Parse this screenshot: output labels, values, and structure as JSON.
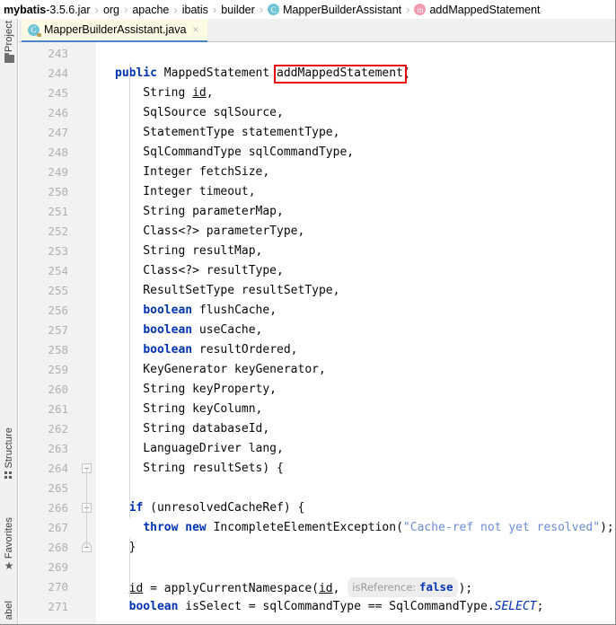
{
  "breadcrumb": {
    "jar_bold": "mybatis",
    "jar_rest": "-3.5.6.jar",
    "items": [
      {
        "label": "org",
        "icon": ""
      },
      {
        "label": "apache",
        "icon": ""
      },
      {
        "label": "ibatis",
        "icon": ""
      },
      {
        "label": "builder",
        "icon": ""
      },
      {
        "label": "MapperBuilderAssistant",
        "icon": "class-icon",
        "glyph": "C"
      },
      {
        "label": "addMappedStatement",
        "icon": "method-icon",
        "glyph": "m"
      }
    ],
    "separator": "›"
  },
  "toolwindows": [
    {
      "name": "project",
      "label": "Project",
      "icon": "folder-icon"
    },
    {
      "name": "structure",
      "label": "Structure",
      "icon": "structure-icon"
    },
    {
      "name": "favorites",
      "label": "Favorites",
      "icon": "star-icon"
    },
    {
      "name": "label",
      "label": "abel",
      "icon": ""
    }
  ],
  "tab": {
    "title": "MapperBuilderAssistant.java",
    "icon_glyph": "C",
    "close_glyph": "×"
  },
  "editor": {
    "first_line": 243,
    "highlight_color": "#e8000d",
    "lines": [
      {
        "n": 243,
        "tokens": []
      },
      {
        "n": 244,
        "tokens": [
          {
            "t": "public",
            "c": "kw"
          },
          {
            "t": " MappedStatement addMappedStatement(",
            "c": "plain"
          }
        ]
      },
      {
        "n": 245,
        "tokens": [
          {
            "t": "    String ",
            "c": "plain"
          },
          {
            "t": "id",
            "c": "und"
          },
          {
            "t": ",",
            "c": "plain"
          }
        ]
      },
      {
        "n": 246,
        "tokens": [
          {
            "t": "    SqlSource sqlSource,",
            "c": "plain"
          }
        ]
      },
      {
        "n": 247,
        "tokens": [
          {
            "t": "    StatementType statementType,",
            "c": "plain"
          }
        ]
      },
      {
        "n": 248,
        "tokens": [
          {
            "t": "    SqlCommandType sqlCommandType,",
            "c": "plain"
          }
        ]
      },
      {
        "n": 249,
        "tokens": [
          {
            "t": "    Integer fetchSize,",
            "c": "plain"
          }
        ]
      },
      {
        "n": 250,
        "tokens": [
          {
            "t": "    Integer timeout,",
            "c": "plain"
          }
        ]
      },
      {
        "n": 251,
        "tokens": [
          {
            "t": "    String parameterMap,",
            "c": "plain"
          }
        ]
      },
      {
        "n": 252,
        "tokens": [
          {
            "t": "    Class<?> parameterType,",
            "c": "plain"
          }
        ]
      },
      {
        "n": 253,
        "tokens": [
          {
            "t": "    String resultMap,",
            "c": "plain"
          }
        ]
      },
      {
        "n": 254,
        "tokens": [
          {
            "t": "    Class<?> resultType,",
            "c": "plain"
          }
        ]
      },
      {
        "n": 255,
        "tokens": [
          {
            "t": "    ResultSetType resultSetType,",
            "c": "plain"
          }
        ]
      },
      {
        "n": 256,
        "tokens": [
          {
            "t": "    ",
            "c": "plain"
          },
          {
            "t": "boolean",
            "c": "kw"
          },
          {
            "t": " flushCache,",
            "c": "plain"
          }
        ]
      },
      {
        "n": 257,
        "tokens": [
          {
            "t": "    ",
            "c": "plain"
          },
          {
            "t": "boolean",
            "c": "kw"
          },
          {
            "t": " useCache,",
            "c": "plain"
          }
        ]
      },
      {
        "n": 258,
        "tokens": [
          {
            "t": "    ",
            "c": "plain"
          },
          {
            "t": "boolean",
            "c": "kw"
          },
          {
            "t": " resultOrdered,",
            "c": "plain"
          }
        ]
      },
      {
        "n": 259,
        "tokens": [
          {
            "t": "    KeyGenerator keyGenerator,",
            "c": "plain"
          }
        ]
      },
      {
        "n": 260,
        "tokens": [
          {
            "t": "    String keyProperty,",
            "c": "plain"
          }
        ]
      },
      {
        "n": 261,
        "tokens": [
          {
            "t": "    String keyColumn,",
            "c": "plain"
          }
        ]
      },
      {
        "n": 262,
        "tokens": [
          {
            "t": "    String databaseId,",
            "c": "plain"
          }
        ]
      },
      {
        "n": 263,
        "tokens": [
          {
            "t": "    LanguageDriver lang,",
            "c": "plain"
          }
        ]
      },
      {
        "n": 264,
        "tokens": [
          {
            "t": "    String resultSets) {",
            "c": "plain"
          }
        ]
      },
      {
        "n": 265,
        "tokens": []
      },
      {
        "n": 266,
        "tokens": [
          {
            "t": "  ",
            "c": "plain"
          },
          {
            "t": "if",
            "c": "kw"
          },
          {
            "t": " (unresolvedCacheRef) {",
            "c": "plain"
          }
        ]
      },
      {
        "n": 267,
        "tokens": [
          {
            "t": "    ",
            "c": "plain"
          },
          {
            "t": "throw",
            "c": "kw"
          },
          {
            "t": " ",
            "c": "plain"
          },
          {
            "t": "new",
            "c": "kw"
          },
          {
            "t": " IncompleteElementException(",
            "c": "plain"
          },
          {
            "t": "\"Cache-ref not yet resolved\"",
            "c": "str"
          },
          {
            "t": ");",
            "c": "plain"
          }
        ]
      },
      {
        "n": 268,
        "tokens": [
          {
            "t": "  }",
            "c": "plain"
          }
        ]
      },
      {
        "n": 269,
        "tokens": []
      },
      {
        "n": 270,
        "tokens": [
          {
            "t": "  ",
            "c": "plain"
          },
          {
            "t": "id",
            "c": "und"
          },
          {
            "t": " = applyCurrentNamespace(",
            "c": "plain"
          },
          {
            "t": "id",
            "c": "und"
          },
          {
            "t": ", ",
            "c": "plain"
          },
          {
            "t": "isReference:",
            "c": "hint",
            "hintvalue": "false"
          },
          {
            "t": ");",
            "c": "plain"
          }
        ]
      },
      {
        "n": 271,
        "tokens": [
          {
            "t": "  ",
            "c": "plain"
          },
          {
            "t": "boolean",
            "c": "kw"
          },
          {
            "t": " isSelect = sqlCommandType == SqlCommandType.",
            "c": "plain"
          },
          {
            "t": "SELECT",
            "c": "ital"
          },
          {
            "t": ";",
            "c": "plain"
          }
        ]
      }
    ],
    "fold_markers": [
      264,
      266,
      268
    ],
    "highlighted_token": "addMappedStatement"
  }
}
